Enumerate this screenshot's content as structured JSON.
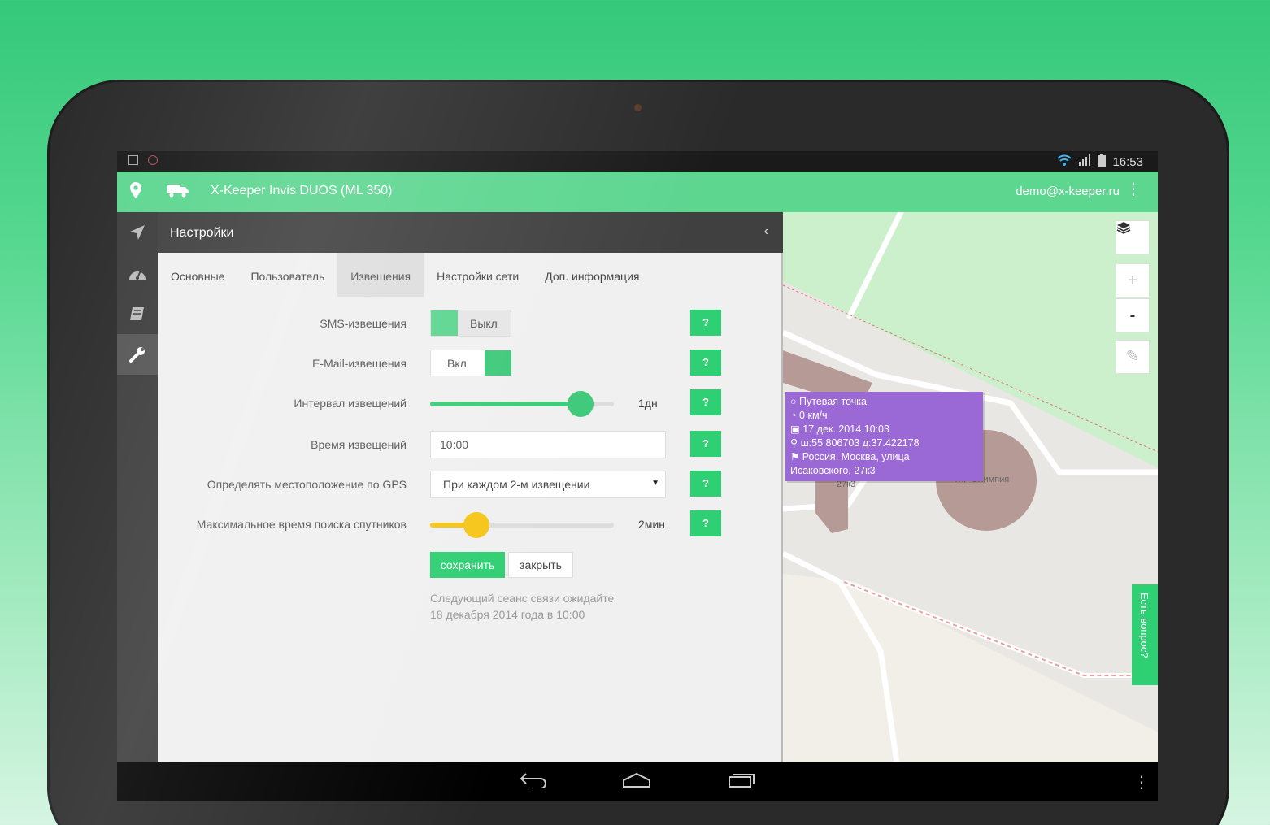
{
  "status_bar": {
    "time": "16:53"
  },
  "app_bar": {
    "title": "X-Keeper Invis DUOS (ML 350)",
    "user_email": "demo@x-keeper.ru"
  },
  "panel": {
    "title": "Настройки",
    "tabs": [
      {
        "label": "Основные",
        "active": false
      },
      {
        "label": "Пользователь",
        "active": false
      },
      {
        "label": "Извещения",
        "active": true
      },
      {
        "label": "Настройки сети",
        "active": false
      },
      {
        "label": "Доп. информация",
        "active": false
      }
    ],
    "fields": {
      "sms": {
        "label": "SMS-извещения",
        "state": "Выкл"
      },
      "email": {
        "label": "E-Mail-извещения",
        "state": "Вкл"
      },
      "interval": {
        "label": "Интервал извещений",
        "value_label": "1дн",
        "fraction": 0.82,
        "color": "#3ec97a"
      },
      "time": {
        "label": "Время извещений",
        "value": "10:00"
      },
      "gps": {
        "label": "Определять местоположение по GPS",
        "selected": "При каждом 2-м извещении"
      },
      "sat_search": {
        "label": "Максимальное время поиска спутников",
        "value_label": "2мин",
        "fraction": 0.25,
        "color": "#f5c518"
      }
    },
    "help_label": "?",
    "save_label": "сохранить",
    "close_label": "закрыть",
    "next_session_line1": "Следующий сеанс связи ожидайте",
    "next_session_line2": "18 декабря 2014 года в 10:00"
  },
  "map": {
    "popup": {
      "title": "Путевая точка",
      "speed": "0 км/ч",
      "datetime": "17 дек. 2014 10:03",
      "coords": "ш:55.806703 д:37.422178",
      "address_line1": "Россия, Москва, улица",
      "address_line2": "Исаковского, 27к3"
    },
    "labels": {
      "building": "27к3",
      "complex": "ЖК Олимпия"
    },
    "zoom_in": "+",
    "zoom_out": "-",
    "help_tab": "Есть вопрос?"
  },
  "colors": {
    "accent": "#2fcf73",
    "app_bar": "#5dd690",
    "popup": "#9b69d6"
  }
}
